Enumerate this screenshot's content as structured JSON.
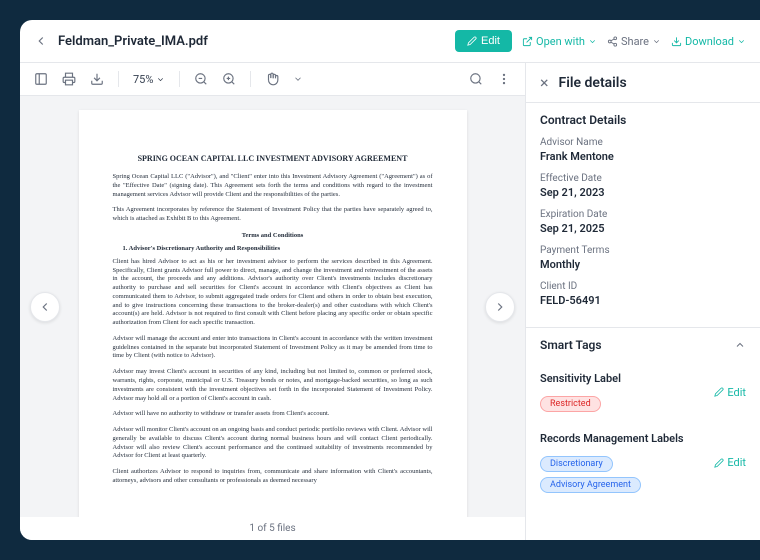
{
  "header": {
    "filename": "Feldman_Private_IMA.pdf",
    "edit": "Edit",
    "openWith": "Open with",
    "share": "Share",
    "download": "Download"
  },
  "toolbar": {
    "zoom": "75%"
  },
  "document": {
    "title": "SPRING OCEAN CAPITAL LLC INVESTMENT ADVISORY AGREEMENT",
    "p1": "Spring Ocean Capital LLC (\"Advisor\"), and \"Client\" enter into this Investment Advisory Agreement (\"Agreement\") as of the \"Effective Date\" (signing date). This Agreement sets forth the terms and conditions with regard to the investment management services Advisor will provide Client and the responsibilities of the parties.",
    "p2": "This Agreement incorporates by reference the Statement of Investment Policy that the parties have separately agreed to, which is attached as Exhibit B to this Agreement.",
    "h2": "Terms and Conditions",
    "li1": "1.   Advisor's Discretionary Authority and Responsibilities",
    "p3": "Client has hired Advisor to act as his or her investment advisor to perform the services described in this Agreement.  Specifically, Client grants Advisor full power to direct, manage, and change the investment and reinvestment of the assets in the account, the proceeds and any additions.  Advisor's authority over Client's investments includes discretionary authority to purchase and sell securities for Client's account in accordance with Client's objectives as Client has communicated them to Advisor, to submit aggregated trade orders for Client and others in order to obtain best execution, and to give instructions concerning these transactions to the broker-dealer(s) and other custodians with which Client's account(s) are held.  Advisor is not required to first consult with Client before placing any specific order or obtain specific authorization from Client for each specific transaction.",
    "p4": "Advisor will manage the account and enter into transactions in Client's account in accordance with the written investment guidelines contained in the separate but incorporated Statement of Investment Policy as it may be amended from time to time by Client (with notice to Advisor).",
    "p5": "Advisor may invest Client's account in securities of any kind, including but not limited to, common or preferred stock, warrants, rights, corporate, municipal or U.S. Treasury bonds or notes, and mortgage-backed securities, so long as such investments are consistent with the investment objectives set forth in the incorporated Statement of Investment Policy.  Advisor may hold all or a portion of Client's account in cash.",
    "p6": "Advisor will have no authority to withdraw or transfer assets from Client's account.",
    "p7": "Advisor will monitor Client's account on an ongoing basis and conduct periodic portfolio reviews with Client.  Advisor will generally be available to discuss Client's account during normal business hours and will contact Client periodically.  Advisor will also review Client's account performance and the continued suitability of investments recommended by Advisor for Client at least quarterly.",
    "p8": "Client authorizes Advisor to respond to inquiries from, communicate and share information with Client's accountants, attorneys, advisors and other consultants or professionals as deemed necessary"
  },
  "pageCounter": "1 of 5 files",
  "sidebar": {
    "title": "File details",
    "contractDetails": "Contract Details",
    "fields": {
      "advisorName": {
        "label": "Advisor Name",
        "value": "Frank Mentone"
      },
      "effectiveDate": {
        "label": "Effective Date",
        "value": "Sep 21, 2023"
      },
      "expirationDate": {
        "label": "Expiration Date",
        "value": "Sep 21, 2025"
      },
      "paymentTerms": {
        "label": "Payment Terms",
        "value": "Monthly"
      },
      "clientId": {
        "label": "Client ID",
        "value": "FELD-56491"
      }
    },
    "smartTags": "Smart Tags",
    "sensitivityLabel": "Sensitivity Label",
    "sensitivityValue": "Restricted",
    "recordsLabel": "Records Management Labels",
    "recordsValues": [
      "Discretionary",
      "Advisory Agreement"
    ],
    "editLink": "Edit"
  }
}
